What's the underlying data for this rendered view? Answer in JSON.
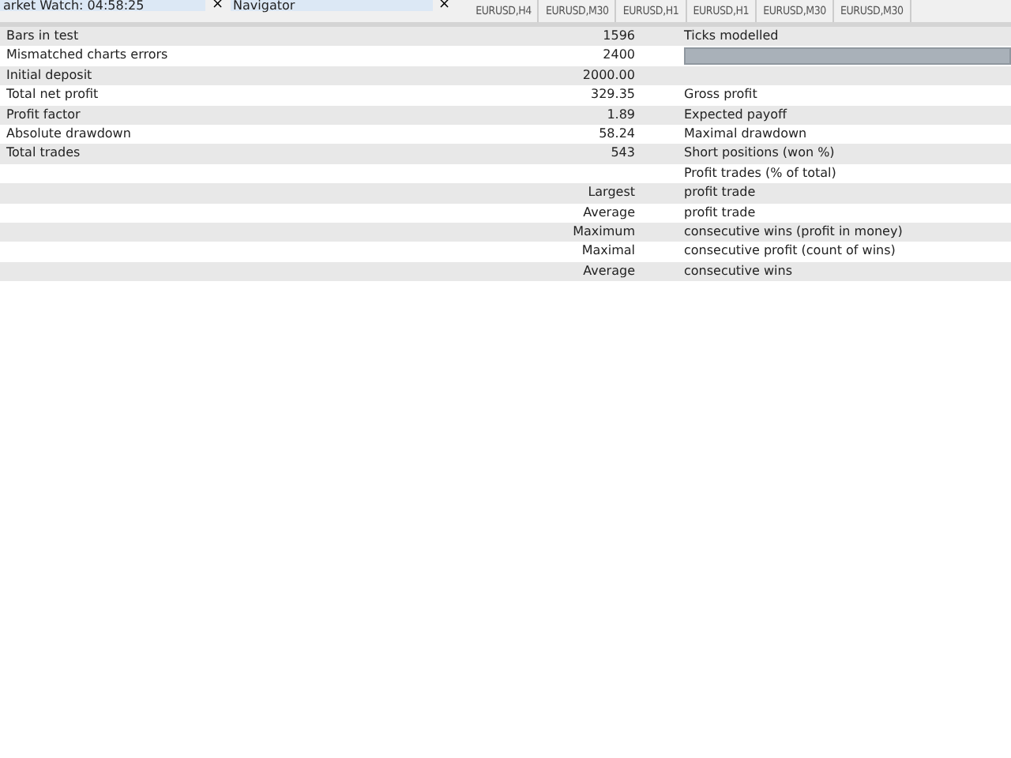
{
  "panels": [
    {
      "title": "arket Watch: 04:58:25",
      "close": "×"
    },
    {
      "title": "Navigator",
      "close": "×"
    }
  ],
  "chart_tabs": [
    {
      "label": "EURUSD,H4"
    },
    {
      "label": "EURUSD,M30"
    },
    {
      "label": "EURUSD,H1"
    },
    {
      "label": "EURUSD,H1"
    },
    {
      "label": "EURUSD,M30"
    },
    {
      "label": "EURUSD,M30"
    }
  ],
  "report_rows": [
    {
      "kind": "text",
      "label": "Bars in test",
      "value": "1596",
      "label_2": "Ticks modelled"
    },
    {
      "kind": "bar",
      "label": "Mismatched charts errors",
      "value": "2400"
    },
    {
      "kind": "text",
      "label": "Initial deposit",
      "value": "2000.00"
    },
    {
      "kind": "text",
      "label": "Total net profit",
      "value": "329.35",
      "label_2": "Gross profit"
    },
    {
      "kind": "text",
      "label": "Profit factor",
      "value": "1.89",
      "label_2": "Expected payoff"
    },
    {
      "kind": "text",
      "label": "Absolute drawdown",
      "value": "58.24",
      "label_2": "Maximal drawdown"
    },
    {
      "kind": "text",
      "label": "Total trades",
      "value": "543",
      "label_2": "Short positions (won %)"
    },
    {
      "kind": "text",
      "label_2": "Profit trades (% of total)"
    },
    {
      "kind": "text",
      "value": "Largest",
      "label_2": "profit trade"
    },
    {
      "kind": "text",
      "value": "Average",
      "label_2": "profit trade"
    },
    {
      "kind": "text",
      "value": "Maximum",
      "label_2": "consecutive wins (profit in money)"
    },
    {
      "kind": "text",
      "value": "Maximal",
      "label_2": "consecutive profit (count of wins)"
    },
    {
      "kind": "text",
      "value": "Average",
      "label_2": "consecutive wins"
    }
  ]
}
